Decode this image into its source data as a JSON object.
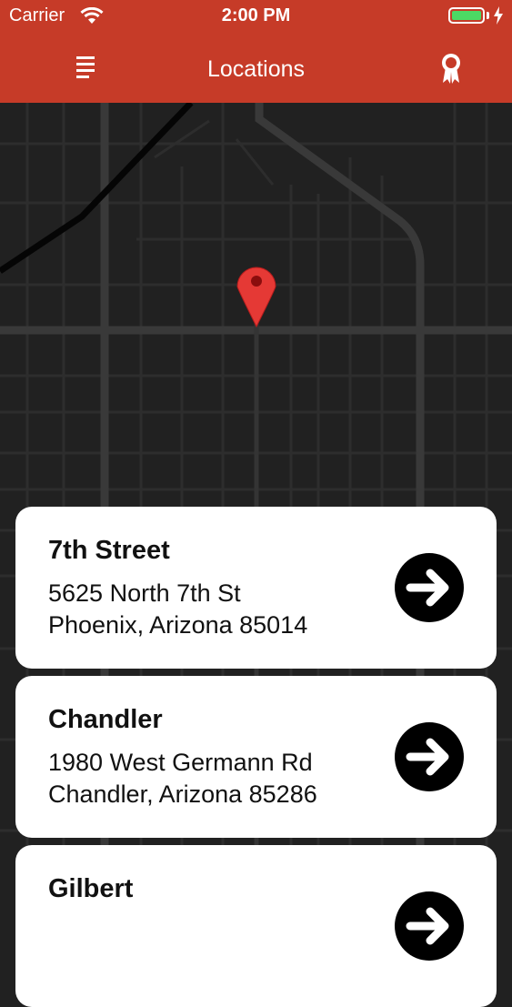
{
  "status_bar": {
    "carrier": "Carrier",
    "time": "2:00 PM",
    "wifi_icon": "wifi-icon",
    "battery_icon": "battery-icon",
    "battery_level": 1.0,
    "charging_icon": "bolt-icon"
  },
  "header": {
    "title": "Locations",
    "menu_icon": "menu-icon",
    "rewards_icon": "award-ribbon-icon",
    "background_color": "#c63b28"
  },
  "map": {
    "theme": "dark",
    "pin_icon": "map-pin-icon",
    "pin_color": "#e53935"
  },
  "locations": [
    {
      "name": "7th Street",
      "address_line1": "5625 North 7th St",
      "address_line2": "Phoenix, Arizona 85014",
      "action_icon": "arrow-right-circle-icon"
    },
    {
      "name": "Chandler",
      "address_line1": "1980 West Germann Rd",
      "address_line2": "Chandler, Arizona 85286",
      "action_icon": "arrow-right-circle-icon"
    },
    {
      "name": "Gilbert",
      "action_icon": "arrow-right-circle-icon"
    }
  ]
}
